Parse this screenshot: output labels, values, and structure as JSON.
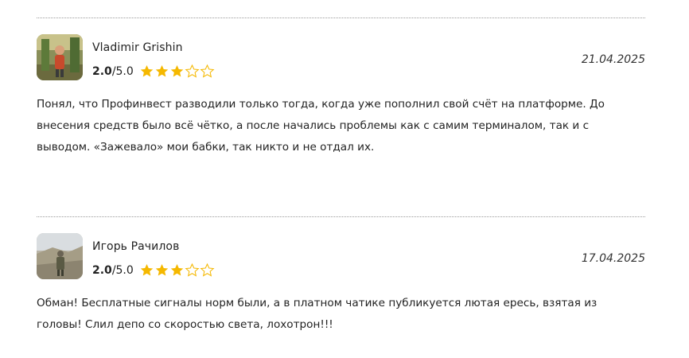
{
  "colors": {
    "star_filled": "#f5b800",
    "star_empty_outline": "#f5b800",
    "divider": "#9a9a9a",
    "text": "#222222"
  },
  "reviews": [
    {
      "author": "Vladimir Grishin",
      "score": "2.0",
      "scale": "/5.0",
      "rating_value": 3,
      "rating_max": 5,
      "date": "21.04.2025",
      "text": "Понял, что Профинвест разводили только тогда, когда уже пополнил свой счёт на платформе. До внесения средств было всё чётко, а после начались проблемы как с самим терминалом, так и с выводом. «Зажевало» мои бабки, так никто и не отдал их."
    },
    {
      "author": "Игорь Рачилов",
      "score": "2.0",
      "scale": "/5.0",
      "rating_value": 3,
      "rating_max": 5,
      "date": "17.04.2025",
      "text": "Обман! Бесплатные сигналы норм были, а в платном чатике публикуется лютая ересь, взятая из головы! Слил депо со скоростью света, лохотрон!!!"
    }
  ]
}
